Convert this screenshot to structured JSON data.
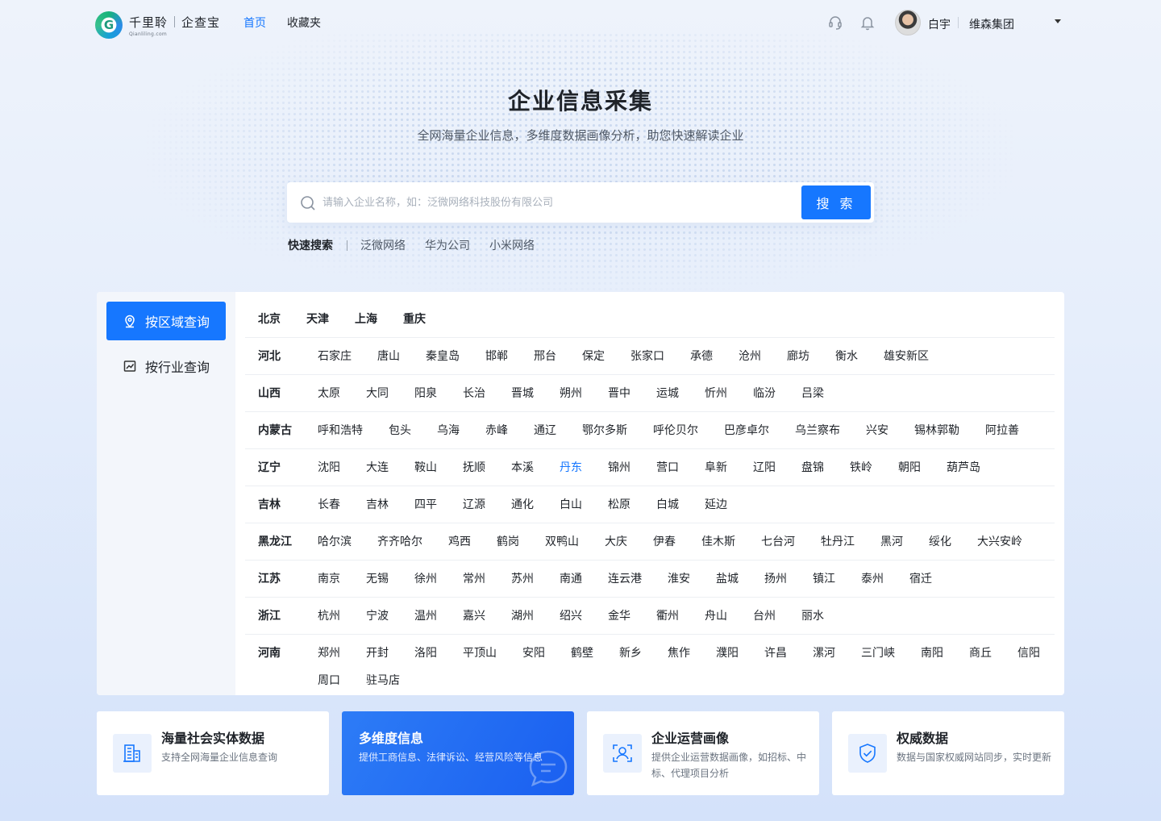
{
  "header": {
    "brand_cn": "千里聆",
    "brand_product": "企查宝",
    "brand_en": "Qianliling.com",
    "logo_glyph": "G",
    "nav": [
      {
        "label": "首页",
        "active": true
      },
      {
        "label": "收藏夹",
        "active": false
      }
    ],
    "user_name": "白宇",
    "org_name": "维森集团",
    "icons": [
      "headset-icon",
      "bell-icon",
      "avatar",
      "chevron-down-icon"
    ]
  },
  "hero": {
    "title": "企业信息采集",
    "subtitle": "全网海量企业信息，多维度数据画像分析，助您快速解读企业"
  },
  "search": {
    "placeholder": "请输入企业名称，如：泛微网络科技股份有限公司",
    "value": "",
    "button": "搜 索"
  },
  "quick_search": {
    "label": "快速搜索",
    "items": [
      "泛微网络",
      "华为公司",
      "小米网络"
    ]
  },
  "side_tabs": [
    {
      "label": "按区域查询",
      "active": true,
      "icon": "location-pin-icon"
    },
    {
      "label": "按行业查询",
      "active": false,
      "icon": "chart-icon"
    }
  ],
  "municipalities": [
    "北京",
    "天津",
    "上海",
    "重庆"
  ],
  "provinces": [
    {
      "name": "河北",
      "cities": [
        "石家庄",
        "唐山",
        "秦皇岛",
        "邯郸",
        "邢台",
        "保定",
        "张家口",
        "承德",
        "沧州",
        "廊坊",
        "衡水",
        "雄安新区"
      ]
    },
    {
      "name": "山西",
      "cities": [
        "太原",
        "大同",
        "阳泉",
        "长治",
        "晋城",
        "朔州",
        "晋中",
        "运城",
        "忻州",
        "临汾",
        "吕梁"
      ]
    },
    {
      "name": "内蒙古",
      "cities": [
        "呼和浩特",
        "包头",
        "乌海",
        "赤峰",
        "通辽",
        "鄂尔多斯",
        "呼伦贝尔",
        "巴彦卓尔",
        "乌兰察布",
        "兴安",
        "锡林郭勒",
        "阿拉善"
      ]
    },
    {
      "name": "辽宁",
      "cities": [
        "沈阳",
        "大连",
        "鞍山",
        "抚顺",
        "本溪",
        "丹东",
        "锦州",
        "营口",
        "阜新",
        "辽阳",
        "盘锦",
        "铁岭",
        "朝阳",
        "葫芦岛"
      ],
      "highlight": "丹东"
    },
    {
      "name": "吉林",
      "cities": [
        "长春",
        "吉林",
        "四平",
        "辽源",
        "通化",
        "白山",
        "松原",
        "白城",
        "延边"
      ]
    },
    {
      "name": "黑龙江",
      "cities": [
        "哈尔滨",
        "齐齐哈尔",
        "鸡西",
        "鹤岗",
        "双鸭山",
        "大庆",
        "伊春",
        "佳木斯",
        "七台河",
        "牡丹江",
        "黑河",
        "绥化",
        "大兴安岭"
      ]
    },
    {
      "name": "江苏",
      "cities": [
        "南京",
        "无锡",
        "徐州",
        "常州",
        "苏州",
        "南通",
        "连云港",
        "淮安",
        "盐城",
        "扬州",
        "镇江",
        "泰州",
        "宿迁"
      ]
    },
    {
      "name": "浙江",
      "cities": [
        "杭州",
        "宁波",
        "温州",
        "嘉兴",
        "湖州",
        "绍兴",
        "金华",
        "衢州",
        "舟山",
        "台州",
        "丽水"
      ]
    },
    {
      "name": "河南",
      "cities": [
        "郑州",
        "开封",
        "洛阳",
        "平顶山",
        "安阳",
        "鹤壁",
        "新乡",
        "焦作",
        "濮阳",
        "许昌",
        "漯河",
        "三门峡",
        "南阳",
        "商丘",
        "信阳",
        "周口",
        "驻马店"
      ]
    }
  ],
  "features": [
    {
      "title": "海量社会实体数据",
      "desc": "支持全网海量企业信息查询",
      "icon": "building-icon",
      "active": false
    },
    {
      "title": "多维度信息",
      "desc": "提供工商信息、法律诉讼、经营风险等信息",
      "icon": "chat-bubble-icon",
      "active": true
    },
    {
      "title": "企业运营画像",
      "desc": "提供企业运营数据画像，如招标、中标、代理项目分析",
      "icon": "user-scan-icon",
      "active": false
    },
    {
      "title": "权威数据",
      "desc": "数据与国家权威网站同步，实时更新",
      "icon": "shield-check-icon",
      "active": false
    }
  ],
  "colors": {
    "accent": "#1677ff",
    "text": "#1f2329",
    "muted": "#6b7480",
    "side_bg": "#f3f6fb"
  }
}
